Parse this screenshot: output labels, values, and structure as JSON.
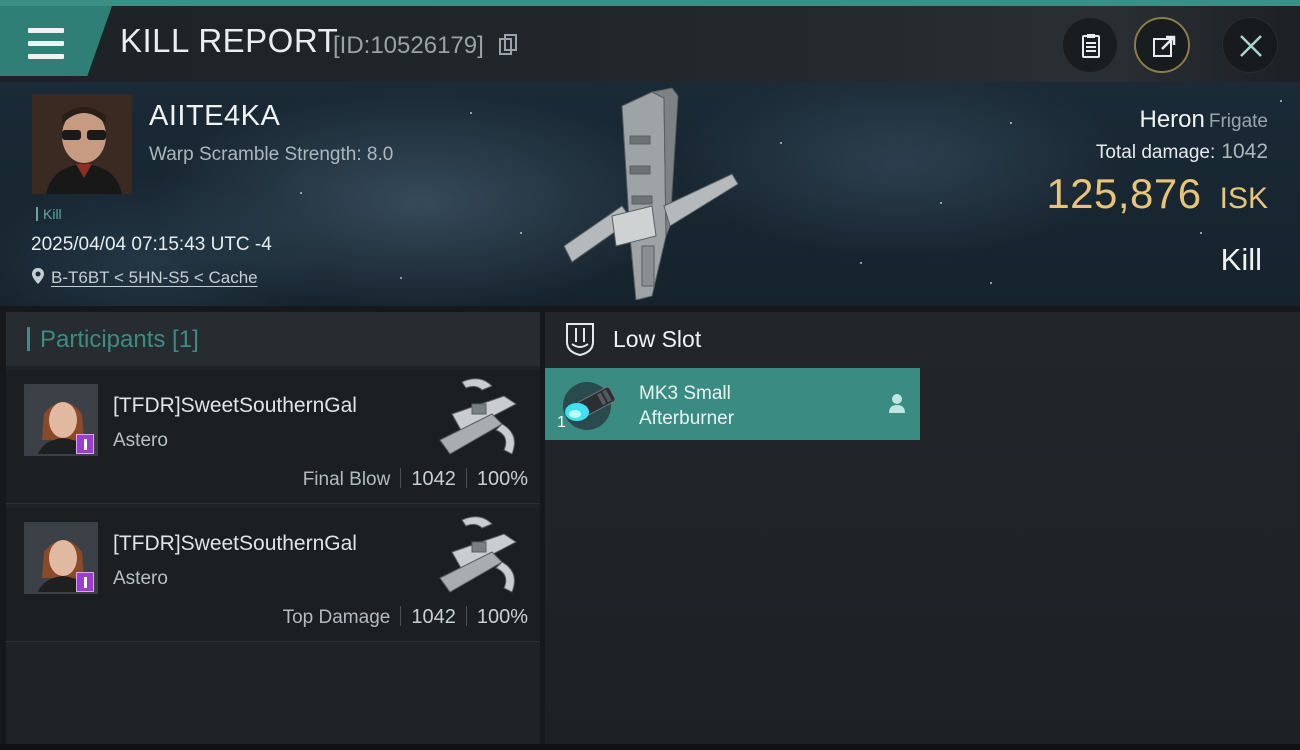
{
  "header": {
    "title": "KILL REPORT",
    "report_id": "[ID:10526179]",
    "icons": [
      "menu-icon",
      "copy-icon",
      "clipboard-icon",
      "share-icon",
      "close-icon"
    ]
  },
  "victim": {
    "pilot_name": "AIITE4KA",
    "warp_scramble": "Warp Scramble Strength: 8.0",
    "tag": "Kill",
    "datetime": "2025/04/04 07:15:43 UTC -4",
    "location": "B-T6BT < 5HN-S5 < Cache"
  },
  "ship": {
    "name": "Heron",
    "class": "Frigate",
    "total_damage_label": "Total damage:",
    "total_damage_value": "1042",
    "isk_value": "125,876",
    "isk_unit": "ISK",
    "result": "Kill"
  },
  "participants": {
    "header": "Participants [1]",
    "list": [
      {
        "name": "[TFDR]SweetSouthernGal",
        "ship": "Astero",
        "role": "Final Blow",
        "damage": "1042",
        "percent": "100%"
      },
      {
        "name": "[TFDR]SweetSouthernGal",
        "ship": "Astero",
        "role": "Top Damage",
        "damage": "1042",
        "percent": "100%"
      }
    ]
  },
  "slots": {
    "title": "Low Slot",
    "modules": [
      {
        "name_line1": "MK3 Small",
        "name_line2": "Afterburner",
        "qty": "1"
      }
    ]
  },
  "colors": {
    "accent": "#3b8f85",
    "isk_gold": "#e8c479",
    "badge_purple": "#9c3dcc"
  }
}
